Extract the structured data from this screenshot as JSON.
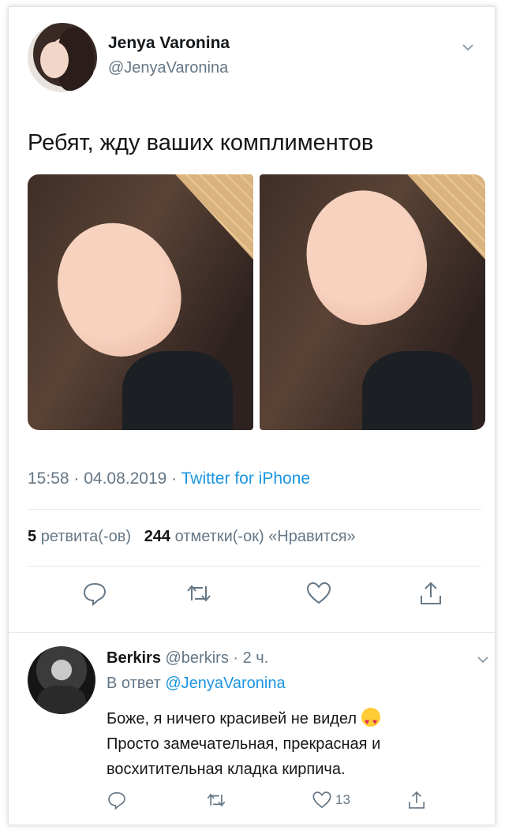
{
  "tweet": {
    "author_name": "Jenya Varonina",
    "author_handle": "@JenyaVaronina",
    "text": "Ребят, жду ваших комплиментов",
    "time": "15:58",
    "sep1": " · ",
    "date": "04.08.2019",
    "sep2": " · ",
    "source": "Twitter for iPhone",
    "retweet_count": "5",
    "retweet_label": "ретвита(-ов)",
    "like_count": "244",
    "like_label": "отметки(-ок) «Нравится»"
  },
  "reply": {
    "author_name": "Berkirs",
    "author_handle": "@berkirs",
    "dot": " · ",
    "time_ago": "2 ч.",
    "reply_to_prefix": "В ответ",
    "reply_to_handle": "@JenyaVaronina",
    "text_line1": "Боже, я ничего красивей не видел",
    "text_line2": "Просто замечательная, прекрасная и",
    "text_line3": "восхитительная кладка кирпича.",
    "like_count": "13"
  },
  "colors": {
    "link": "#1b95e0",
    "muted": "#657786",
    "divider": "#e1e8ed"
  },
  "icons": [
    "chevron-down-icon",
    "reply-icon",
    "retweet-icon",
    "like-icon",
    "share-icon",
    "heart-eyes-emoji"
  ]
}
